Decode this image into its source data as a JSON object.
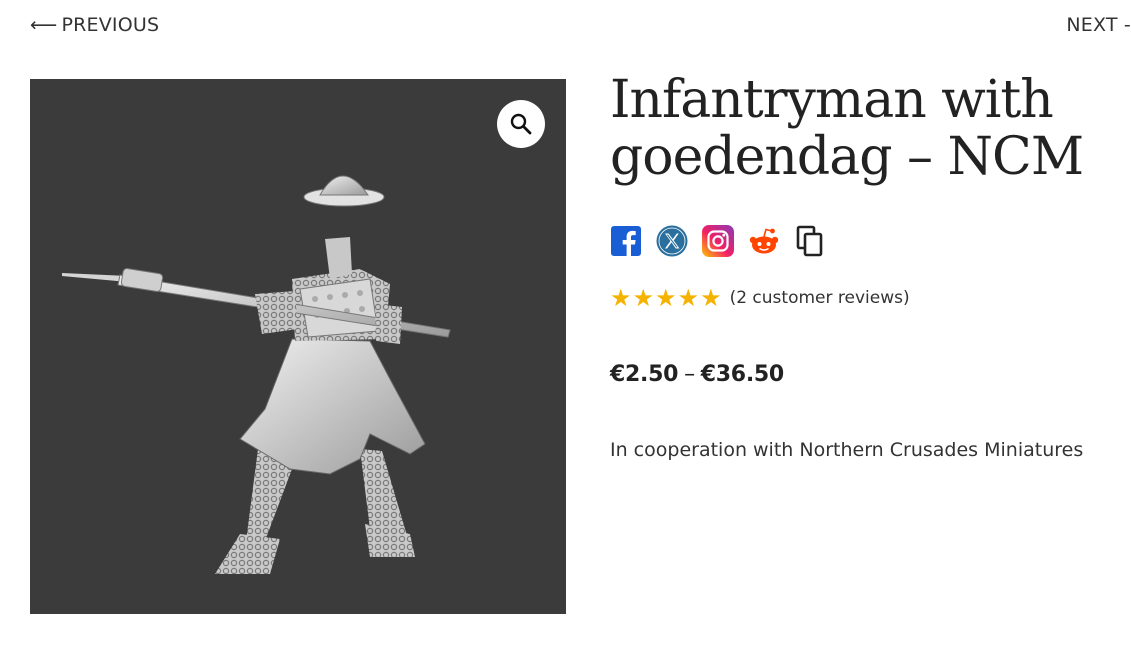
{
  "nav": {
    "previous_arrow": "⟵",
    "previous_label": "PREVIOUS",
    "next_label": "NEXT -"
  },
  "product": {
    "title": "Infantryman with goedendag – NCM",
    "rating": 5,
    "review_text": "(2 customer reviews)",
    "price_min": "€2.50",
    "price_separator": "–",
    "price_max": "€36.50",
    "description": "In cooperation with Northern Crusades Miniatures"
  },
  "image": {
    "background_color": "#3b3b3b",
    "zoom_icon": "magnifier-icon"
  },
  "share": {
    "icons": [
      "facebook-icon",
      "x-icon",
      "instagram-icon",
      "reddit-icon",
      "copy-link-icon"
    ]
  },
  "colors": {
    "star": "#f5b301",
    "facebook": "#1a5ed6",
    "x": "#2a6f9e",
    "reddit": "#ff4500"
  }
}
